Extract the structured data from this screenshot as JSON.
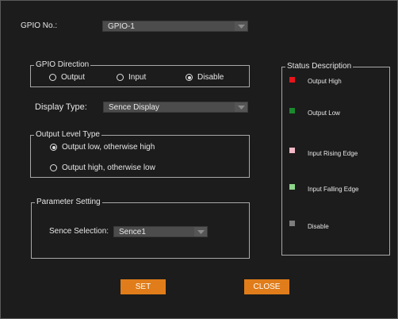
{
  "gpio_no": {
    "label": "GPIO No.:",
    "value": "GPIO-1"
  },
  "gpio_direction": {
    "legend": "GPIO Direction",
    "options": [
      {
        "label": "Output",
        "selected": false
      },
      {
        "label": "Input",
        "selected": false
      },
      {
        "label": "Disable",
        "selected": true
      }
    ]
  },
  "display_type": {
    "label": "Display Type:",
    "value": "Sence Display"
  },
  "output_level_type": {
    "legend": "Output Level Type",
    "options": [
      {
        "label": "Output low, otherwise high",
        "selected": true
      },
      {
        "label": "Output high, otherwise low",
        "selected": false
      }
    ]
  },
  "parameter_setting": {
    "legend": "Parameter Setting",
    "sence_label": "Sence Selection:",
    "sence_value": "Sence1"
  },
  "status_description": {
    "legend": "Status Description",
    "items": [
      {
        "label": "Output High",
        "color": "#e8141a"
      },
      {
        "label": "Output Low",
        "color": "#1b8a2e"
      },
      {
        "label": "Input Rising Edge",
        "color": "#f2b8c6"
      },
      {
        "label": "Input Falling Edge",
        "color": "#8ed68b"
      },
      {
        "label": "Disable",
        "color": "#7d7d7d"
      }
    ]
  },
  "buttons": {
    "set": "SET",
    "close": "CLOSE"
  },
  "colors": {
    "accent": "#e07d1a",
    "background": "#1c1c1c",
    "field": "#4c4c4c"
  }
}
